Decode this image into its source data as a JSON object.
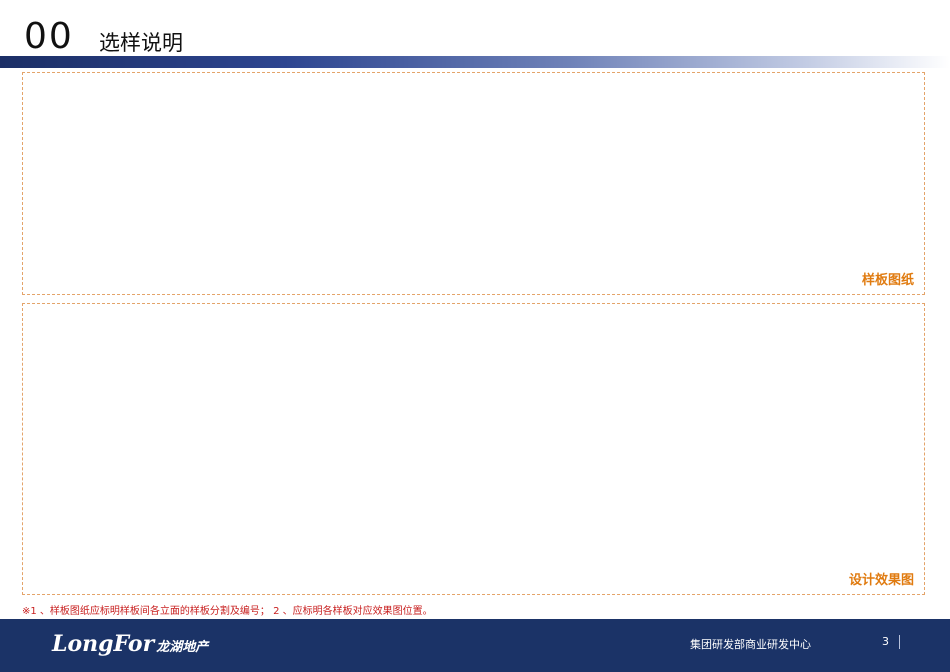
{
  "header": {
    "number": "00",
    "title": "选样说明",
    "bar_gradient": [
      "#1c2f66",
      "#ffffff"
    ]
  },
  "panels": {
    "top_label": "样板图纸",
    "bottom_label": "设计效果图",
    "border_color": "#e4a46a",
    "label_color": "#e07b10"
  },
  "footnote": "※1 、样板图纸应标明样板间各立面的样板分割及编号； 2 、应标明各样板对应效果图位置。",
  "footer": {
    "logo_text": "LongFor",
    "logo_cn": "龙湖地产",
    "department": "集团研发部商业研发中心",
    "page_number": "3",
    "background": "#1b3367"
  }
}
